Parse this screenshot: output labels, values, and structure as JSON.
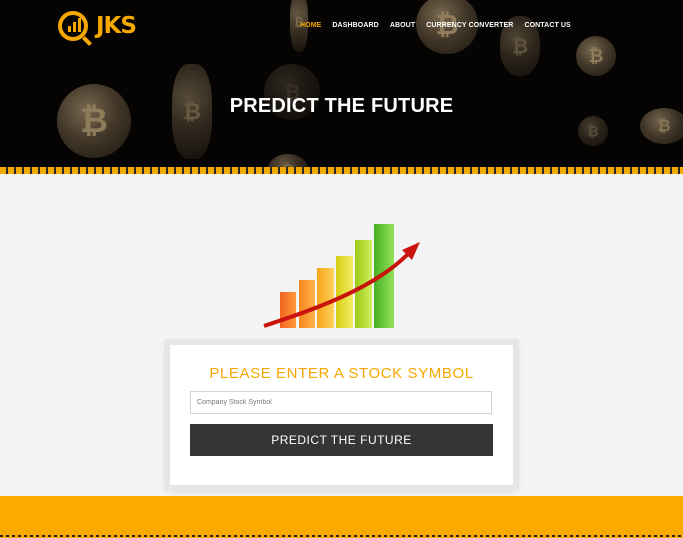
{
  "header": {
    "logo_text": "JKS",
    "nav": [
      {
        "label": "HOME",
        "active": true
      },
      {
        "label": "DASHBOARD",
        "active": false
      },
      {
        "label": "ABOUT",
        "active": false
      },
      {
        "label": "CURRENCY CONVERTER",
        "active": false
      },
      {
        "label": "CONTACT US",
        "active": false
      }
    ]
  },
  "hero": {
    "title": "PREDICT THE FUTURE",
    "coin_symbol": "₿"
  },
  "form": {
    "title": "PLEASE ENTER A STOCK SYMBOL",
    "input_placeholder": "Company Stock Symbol",
    "input_value": "",
    "button_label": "PREDICT THE FUTURE"
  },
  "colors": {
    "accent": "#f5a800",
    "hero_bg": "#050403",
    "button_bg": "#353535",
    "footer_bg": "#fbab00"
  }
}
